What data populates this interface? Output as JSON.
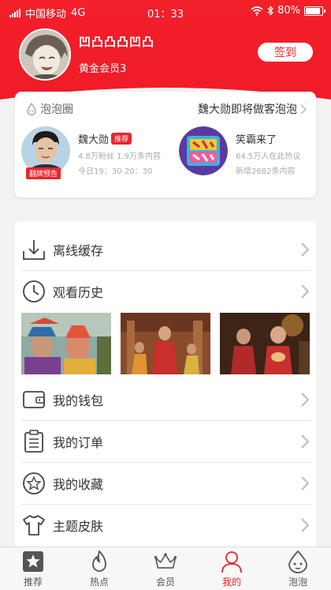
{
  "status_bar": {
    "carrier": "中国移动",
    "network": "4G",
    "time": "01：33",
    "battery": "80%"
  },
  "profile": {
    "username": "凹凸凸凸凹凸",
    "member_level": "黄金会员3",
    "signin_label": "签到"
  },
  "bubble_circle": {
    "title": "泡泡圈",
    "promo_text": "魏大勋即将做客泡泡",
    "people": [
      {
        "name": "魏大勋",
        "badge": "推荐",
        "stats": "4.8万粉丝 1.9万条内容",
        "schedule": "今日19：30-20：30",
        "tag": "翻牌预告"
      },
      {
        "name": "笑霸来了",
        "stats": "64.5万人在此热议",
        "schedule": "新增2682条内容"
      }
    ]
  },
  "menu": {
    "items": [
      {
        "label": "离线缓存",
        "icon": "download-icon"
      },
      {
        "label": "观看历史",
        "icon": "clock-icon"
      },
      {
        "label": "我的钱包",
        "icon": "wallet-icon"
      },
      {
        "label": "我的订单",
        "icon": "order-list-icon"
      },
      {
        "label": "我的收藏",
        "icon": "star-icon"
      },
      {
        "label": "主题皮肤",
        "icon": "tshirt-icon"
      }
    ]
  },
  "tabbar": {
    "tabs": [
      {
        "label": "推荐",
        "icon": "star-box-icon"
      },
      {
        "label": "热点",
        "icon": "flame-icon"
      },
      {
        "label": "会员",
        "icon": "crown-icon"
      },
      {
        "label": "我的",
        "icon": "person-icon",
        "active": true
      },
      {
        "label": "泡泡",
        "icon": "bubble-face-icon"
      }
    ]
  },
  "colors": {
    "brand_red": "#e8262d",
    "background": "#f2f2f2"
  }
}
